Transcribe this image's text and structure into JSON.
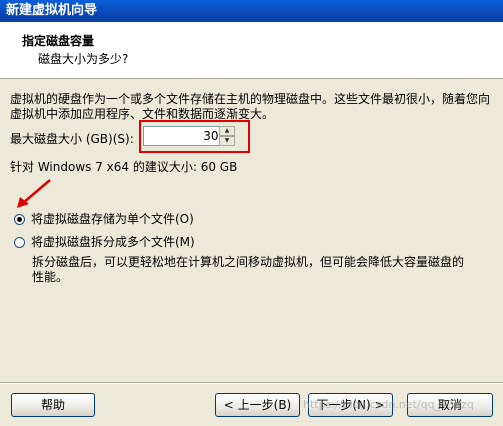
{
  "window": {
    "title": "新建虚拟机向导"
  },
  "header": {
    "title": "指定磁盘容量",
    "subtitle": "磁盘大小为多少?"
  },
  "description": "虚拟机的硬盘作为一个或多个文件存储在主机的物理磁盘中。这些文件最初很小，随着您向虚拟机中添加应用程序、文件和数据而逐渐变大。",
  "disk_size": {
    "label": "最大磁盘大小 (GB)(S):",
    "value": "30.0"
  },
  "recommendation": "针对 Windows 7 x64 的建议大小: 60 GB",
  "options": [
    {
      "label": "将虚拟磁盘存储为单个文件(O)",
      "checked": true
    },
    {
      "label": "将虚拟磁盘拆分成多个文件(M)",
      "checked": false
    }
  ],
  "split_note": "拆分磁盘后，可以更轻松地在计算机之间移动虚拟机，但可能会降低大容量磁盘的性能。",
  "buttons": {
    "help": "帮助",
    "back": "< 上一步(B)",
    "next": "下一步(N) >",
    "cancel": "取消"
  },
  "watermark": "https://blog.csdn.net/qq_43hzq",
  "colors": {
    "title_bar": "#0b49b8",
    "highlight": "#e00000",
    "arrow": "#e00000"
  }
}
